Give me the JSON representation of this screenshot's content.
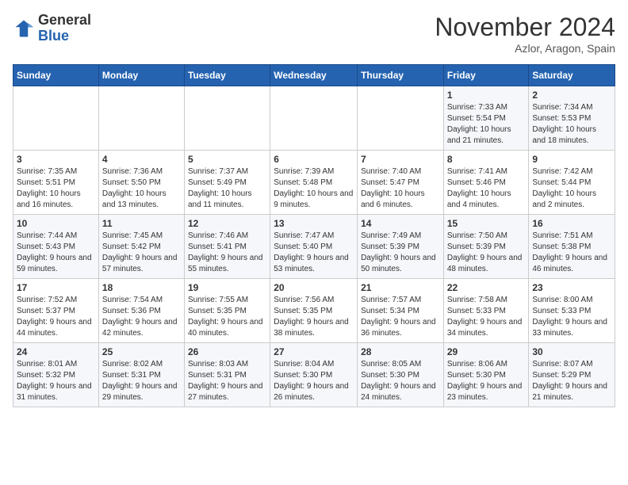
{
  "logo": {
    "general": "General",
    "blue": "Blue"
  },
  "header": {
    "month": "November 2024",
    "location": "Azlor, Aragon, Spain"
  },
  "weekdays": [
    "Sunday",
    "Monday",
    "Tuesday",
    "Wednesday",
    "Thursday",
    "Friday",
    "Saturday"
  ],
  "weeks": [
    [
      {
        "day": "",
        "info": ""
      },
      {
        "day": "",
        "info": ""
      },
      {
        "day": "",
        "info": ""
      },
      {
        "day": "",
        "info": ""
      },
      {
        "day": "",
        "info": ""
      },
      {
        "day": "1",
        "info": "Sunrise: 7:33 AM\nSunset: 5:54 PM\nDaylight: 10 hours and 21 minutes."
      },
      {
        "day": "2",
        "info": "Sunrise: 7:34 AM\nSunset: 5:53 PM\nDaylight: 10 hours and 18 minutes."
      }
    ],
    [
      {
        "day": "3",
        "info": "Sunrise: 7:35 AM\nSunset: 5:51 PM\nDaylight: 10 hours and 16 minutes."
      },
      {
        "day": "4",
        "info": "Sunrise: 7:36 AM\nSunset: 5:50 PM\nDaylight: 10 hours and 13 minutes."
      },
      {
        "day": "5",
        "info": "Sunrise: 7:37 AM\nSunset: 5:49 PM\nDaylight: 10 hours and 11 minutes."
      },
      {
        "day": "6",
        "info": "Sunrise: 7:39 AM\nSunset: 5:48 PM\nDaylight: 10 hours and 9 minutes."
      },
      {
        "day": "7",
        "info": "Sunrise: 7:40 AM\nSunset: 5:47 PM\nDaylight: 10 hours and 6 minutes."
      },
      {
        "day": "8",
        "info": "Sunrise: 7:41 AM\nSunset: 5:46 PM\nDaylight: 10 hours and 4 minutes."
      },
      {
        "day": "9",
        "info": "Sunrise: 7:42 AM\nSunset: 5:44 PM\nDaylight: 10 hours and 2 minutes."
      }
    ],
    [
      {
        "day": "10",
        "info": "Sunrise: 7:44 AM\nSunset: 5:43 PM\nDaylight: 9 hours and 59 minutes."
      },
      {
        "day": "11",
        "info": "Sunrise: 7:45 AM\nSunset: 5:42 PM\nDaylight: 9 hours and 57 minutes."
      },
      {
        "day": "12",
        "info": "Sunrise: 7:46 AM\nSunset: 5:41 PM\nDaylight: 9 hours and 55 minutes."
      },
      {
        "day": "13",
        "info": "Sunrise: 7:47 AM\nSunset: 5:40 PM\nDaylight: 9 hours and 53 minutes."
      },
      {
        "day": "14",
        "info": "Sunrise: 7:49 AM\nSunset: 5:39 PM\nDaylight: 9 hours and 50 minutes."
      },
      {
        "day": "15",
        "info": "Sunrise: 7:50 AM\nSunset: 5:39 PM\nDaylight: 9 hours and 48 minutes."
      },
      {
        "day": "16",
        "info": "Sunrise: 7:51 AM\nSunset: 5:38 PM\nDaylight: 9 hours and 46 minutes."
      }
    ],
    [
      {
        "day": "17",
        "info": "Sunrise: 7:52 AM\nSunset: 5:37 PM\nDaylight: 9 hours and 44 minutes."
      },
      {
        "day": "18",
        "info": "Sunrise: 7:54 AM\nSunset: 5:36 PM\nDaylight: 9 hours and 42 minutes."
      },
      {
        "day": "19",
        "info": "Sunrise: 7:55 AM\nSunset: 5:35 PM\nDaylight: 9 hours and 40 minutes."
      },
      {
        "day": "20",
        "info": "Sunrise: 7:56 AM\nSunset: 5:35 PM\nDaylight: 9 hours and 38 minutes."
      },
      {
        "day": "21",
        "info": "Sunrise: 7:57 AM\nSunset: 5:34 PM\nDaylight: 9 hours and 36 minutes."
      },
      {
        "day": "22",
        "info": "Sunrise: 7:58 AM\nSunset: 5:33 PM\nDaylight: 9 hours and 34 minutes."
      },
      {
        "day": "23",
        "info": "Sunrise: 8:00 AM\nSunset: 5:33 PM\nDaylight: 9 hours and 33 minutes."
      }
    ],
    [
      {
        "day": "24",
        "info": "Sunrise: 8:01 AM\nSunset: 5:32 PM\nDaylight: 9 hours and 31 minutes."
      },
      {
        "day": "25",
        "info": "Sunrise: 8:02 AM\nSunset: 5:31 PM\nDaylight: 9 hours and 29 minutes."
      },
      {
        "day": "26",
        "info": "Sunrise: 8:03 AM\nSunset: 5:31 PM\nDaylight: 9 hours and 27 minutes."
      },
      {
        "day": "27",
        "info": "Sunrise: 8:04 AM\nSunset: 5:30 PM\nDaylight: 9 hours and 26 minutes."
      },
      {
        "day": "28",
        "info": "Sunrise: 8:05 AM\nSunset: 5:30 PM\nDaylight: 9 hours and 24 minutes."
      },
      {
        "day": "29",
        "info": "Sunrise: 8:06 AM\nSunset: 5:30 PM\nDaylight: 9 hours and 23 minutes."
      },
      {
        "day": "30",
        "info": "Sunrise: 8:07 AM\nSunset: 5:29 PM\nDaylight: 9 hours and 21 minutes."
      }
    ]
  ]
}
